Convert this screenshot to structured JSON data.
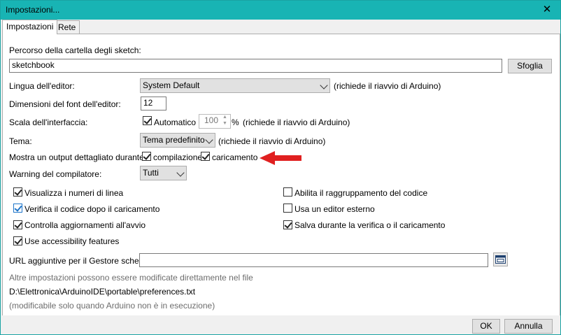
{
  "window": {
    "title": "Impostazioni...",
    "close_glyph": "✕"
  },
  "tabs": [
    {
      "label": "Impostazioni",
      "active": true
    },
    {
      "label": "Rete",
      "active": false
    }
  ],
  "sketch_folder": {
    "label": "Percorso della cartella degli sketch:",
    "value": "sketchbook",
    "browse_label": "Sfoglia"
  },
  "editor_language": {
    "label": "Lingua dell'editor:",
    "value": "System Default",
    "note": "(richiede il riavvio di Arduino)"
  },
  "font_size": {
    "label": "Dimensioni del font dell'editor:",
    "value": "12"
  },
  "interface_scale": {
    "label": "Scala dell'interfaccia:",
    "auto_label": "Automatico",
    "auto_checked": true,
    "value": "100",
    "unit": "%",
    "note": "(richiede il riavvio di Arduino)"
  },
  "theme": {
    "label": "Tema:",
    "value": "Tema predefinito",
    "note": "(richiede il riavvio di Arduino)"
  },
  "verbose_output": {
    "label": "Mostra un output dettagliato durante:",
    "compile_label": "compilazione",
    "compile_checked": true,
    "upload_label": "caricamento",
    "upload_checked": true
  },
  "arrow": {
    "color": "#e02020"
  },
  "compiler_warnings": {
    "label": "Warning del compilatore:",
    "value": "Tutti"
  },
  "options_left": [
    {
      "label": "Visualizza i numeri di linea",
      "checked": true
    },
    {
      "label": "Verifica il codice dopo il caricamento",
      "checked": true
    },
    {
      "label": "Controlla aggiornamenti all'avvio",
      "checked": true
    },
    {
      "label": "Use accessibility features",
      "checked": true
    }
  ],
  "options_right": [
    {
      "label": "Abilita il raggruppamento del codice",
      "checked": false
    },
    {
      "label": "Usa un editor esterno",
      "checked": false
    },
    {
      "label": "Salva durante la verifica o il caricamento",
      "checked": true
    }
  ],
  "board_urls": {
    "label": "URL aggiuntive per il Gestore schede:",
    "value": "",
    "icon": "window-list-icon"
  },
  "info": {
    "more_prefs": "Altre impostazioni possono essere modificate direttamente nel file",
    "prefs_path": "D:\\Elettronica\\ArduinoIDE\\portable\\preferences.txt",
    "edit_note": "(modificabile solo quando Arduino non è in esecuzione)"
  },
  "footer": {
    "ok_label": "OK",
    "cancel_label": "Annulla"
  }
}
